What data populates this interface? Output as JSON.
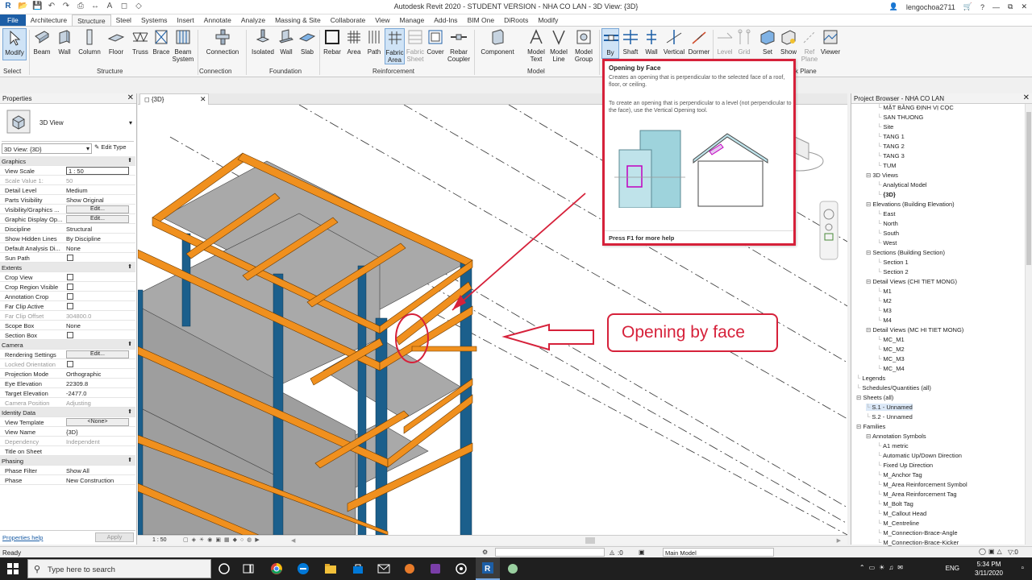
{
  "titlebar": {
    "title": "Autodesk Revit 2020 - STUDENT VERSION - NHA CO LAN - 3D View: {3D}",
    "user": "lengochoa2711"
  },
  "menu_tabs": [
    "File",
    "Architecture",
    "Structure",
    "Steel",
    "Systems",
    "Insert",
    "Annotate",
    "Analyze",
    "Massing & Site",
    "Collaborate",
    "View",
    "Manage",
    "Add-Ins",
    "BIM One",
    "DiRoots",
    "Modify"
  ],
  "active_tab": "Structure",
  "ribbon": {
    "buttons": {
      "modify": "Modify",
      "beam": "Beam",
      "wall": "Wall",
      "column": "Column",
      "floor": "Floor",
      "truss": "Truss",
      "brace": "Brace",
      "beam_system_1": "Beam",
      "beam_system_2": "System",
      "connection": "Connection",
      "isolated": "Isolated",
      "wall_found": "Wall",
      "slab": "Slab",
      "rebar": "Rebar",
      "area": "Area",
      "path": "Path",
      "fabric_area_1": "Fabric",
      "fabric_area_2": "Area",
      "fabric_sheet_1": "Fabric",
      "fabric_sheet_2": "Sheet",
      "cover": "Cover",
      "rebar_coupler_1": "Rebar",
      "rebar_coupler_2": "Coupler",
      "component": "Component",
      "model_text_1": "Model",
      "model_text_2": "Text",
      "model_line_1": "Model",
      "model_line_2": "Line",
      "model_group_1": "Model",
      "model_group_2": "Group",
      "by_face": "By",
      "shaft": "Shaft",
      "wall_open": "Wall",
      "vertical": "Vertical",
      "dormer": "Dormer",
      "level": "Level",
      "grid": "Grid",
      "set": "Set",
      "show": "Show",
      "ref_plane_1": "Ref",
      "ref_plane_2": "Plane",
      "viewer": "Viewer"
    },
    "groups": {
      "select": "Select",
      "structure": "Structure",
      "connection": "Connection",
      "foundation": "Foundation",
      "reinforcement": "Reinforcement",
      "model": "Model",
      "work_plane": "k Plane"
    }
  },
  "tooltip": {
    "title": "Opening by Face",
    "desc1": "Creates an opening that is perpendicular to the selected face of a roof, floor, or ceiling.",
    "desc2": "To create an opening that is perpendicular to a level (not perpendicular to the face), use the Vertical Opening tool.",
    "help": "Press F1 for more help"
  },
  "properties": {
    "title": "Properties",
    "type_name": "3D View",
    "selector": "3D View: {3D}",
    "edit_type": "Edit Type",
    "rows": [
      {
        "k": "Graphics",
        "sec": true
      },
      {
        "k": "View Scale",
        "v": "1 : 50",
        "box": true
      },
      {
        "k": "Scale Value    1:",
        "v": "50",
        "dim": true
      },
      {
        "k": "Detail Level",
        "v": "Medium"
      },
      {
        "k": "Parts Visibility",
        "v": "Show Original"
      },
      {
        "k": "Visibility/Graphics ...",
        "btn": "Edit..."
      },
      {
        "k": "Graphic Display Op...",
        "btn": "Edit..."
      },
      {
        "k": "Discipline",
        "v": "Structural"
      },
      {
        "k": "Show Hidden Lines",
        "v": "By Discipline"
      },
      {
        "k": "Default Analysis Di...",
        "v": "None"
      },
      {
        "k": "Sun Path",
        "chk": true
      },
      {
        "k": "Extents",
        "sec": true
      },
      {
        "k": "Crop View",
        "chk": true
      },
      {
        "k": "Crop Region Visible",
        "chk": true
      },
      {
        "k": "Annotation Crop",
        "chk": true
      },
      {
        "k": "Far Clip Active",
        "chk": true
      },
      {
        "k": "Far Clip Offset",
        "v": "304800.0",
        "dim": true
      },
      {
        "k": "Scope Box",
        "v": "None"
      },
      {
        "k": "Section Box",
        "chk": true
      },
      {
        "k": "Camera",
        "sec": true
      },
      {
        "k": "Rendering Settings",
        "btn": "Edit..."
      },
      {
        "k": "Locked Orientation",
        "chk": true,
        "dim": true
      },
      {
        "k": "Projection Mode",
        "v": "Orthographic"
      },
      {
        "k": "Eye Elevation",
        "v": "22309.8"
      },
      {
        "k": "Target Elevation",
        "v": "-2477.0"
      },
      {
        "k": "Camera Position",
        "v": "Adjusting",
        "dim": true
      },
      {
        "k": "Identity Data",
        "sec": true
      },
      {
        "k": "View Template",
        "btn": "<None>"
      },
      {
        "k": "View Name",
        "v": "{3D}"
      },
      {
        "k": "Dependency",
        "v": "Independent",
        "dim": true
      },
      {
        "k": "Title on Sheet",
        "v": ""
      },
      {
        "k": "Phasing",
        "sec": true
      },
      {
        "k": "Phase Filter",
        "v": "Show All"
      },
      {
        "k": "Phase",
        "v": "New Construction"
      }
    ],
    "help_link": "Properties help",
    "apply": "Apply"
  },
  "view": {
    "tab_label": "{3D}",
    "scale": "1 : 50",
    "callout": "Opening by face"
  },
  "browser": {
    "title": "Project Browser - NHA CO LAN",
    "nodes": [
      {
        "t": "MẶT BẰNG ĐỊNH VỊ CỌC",
        "lvl": 3
      },
      {
        "t": "SAN THUONG",
        "lvl": 3
      },
      {
        "t": "Site",
        "lvl": 3
      },
      {
        "t": "TANG 1",
        "lvl": 3
      },
      {
        "t": "TANG 2",
        "lvl": 3
      },
      {
        "t": "TANG 3",
        "lvl": 3
      },
      {
        "t": "TUM",
        "lvl": 3
      },
      {
        "t": "3D Views",
        "lvl": 2,
        "exp": true
      },
      {
        "t": "Analytical Model",
        "lvl": 3
      },
      {
        "t": "{3D}",
        "lvl": 3,
        "bold": true
      },
      {
        "t": "Elevations (Building Elevation)",
        "lvl": 2,
        "exp": true
      },
      {
        "t": "East",
        "lvl": 3
      },
      {
        "t": "North",
        "lvl": 3
      },
      {
        "t": "South",
        "lvl": 3
      },
      {
        "t": "West",
        "lvl": 3
      },
      {
        "t": "Sections (Building Section)",
        "lvl": 2,
        "exp": true
      },
      {
        "t": "Section 1",
        "lvl": 3
      },
      {
        "t": "Section 2",
        "lvl": 3
      },
      {
        "t": "Detail Views (CHI TIET MONG)",
        "lvl": 2,
        "exp": true
      },
      {
        "t": "M1",
        "lvl": 3
      },
      {
        "t": "M2",
        "lvl": 3
      },
      {
        "t": "M3",
        "lvl": 3
      },
      {
        "t": "M4",
        "lvl": 3
      },
      {
        "t": "Detail Views (MC HI TIET MONG)",
        "lvl": 2,
        "exp": true
      },
      {
        "t": "MC_M1",
        "lvl": 3
      },
      {
        "t": "MC_M2",
        "lvl": 3
      },
      {
        "t": "MC_M3",
        "lvl": 3
      },
      {
        "t": "MC_M4",
        "lvl": 3
      },
      {
        "t": "Legends",
        "lvl": 1
      },
      {
        "t": "Schedules/Quantities (all)",
        "lvl": 1
      },
      {
        "t": "Sheets (all)",
        "lvl": 1,
        "exp": true
      },
      {
        "t": "S.1 - Unnamed",
        "lvl": 2,
        "sel": true
      },
      {
        "t": "S.2 - Unnamed",
        "lvl": 2
      },
      {
        "t": "Families",
        "lvl": 1,
        "exp": true
      },
      {
        "t": "Annotation Symbols",
        "lvl": 2,
        "exp": true
      },
      {
        "t": "A1 metric",
        "lvl": 3
      },
      {
        "t": "Automatic Up/Down Direction",
        "lvl": 3
      },
      {
        "t": "Fixed Up Direction",
        "lvl": 3
      },
      {
        "t": "M_Anchor Tag",
        "lvl": 3
      },
      {
        "t": "M_Area Reinforcement Symbol",
        "lvl": 3
      },
      {
        "t": "M_Area Reinforcement Tag",
        "lvl": 3
      },
      {
        "t": "M_Bolt Tag",
        "lvl": 3
      },
      {
        "t": "M_Callout Head",
        "lvl": 3
      },
      {
        "t": "M_Centreline",
        "lvl": 3
      },
      {
        "t": "M_Connection-Brace-Angle",
        "lvl": 3
      },
      {
        "t": "M_Connection-Brace-Kicker",
        "lvl": 3
      }
    ]
  },
  "status": {
    "text": "Ready",
    "zero": ":0",
    "model": "Main Model"
  },
  "taskbar": {
    "search_placeholder": "Type here to search",
    "lang": "ENG",
    "time": "5:34 PM",
    "date": "3/11/2020"
  },
  "colors": {
    "beam": "#f0901e",
    "column": "#1b5f8c",
    "slab": "#a9a9a9",
    "annotation": "#d6213a",
    "file_tab": "#1c5ea6"
  }
}
